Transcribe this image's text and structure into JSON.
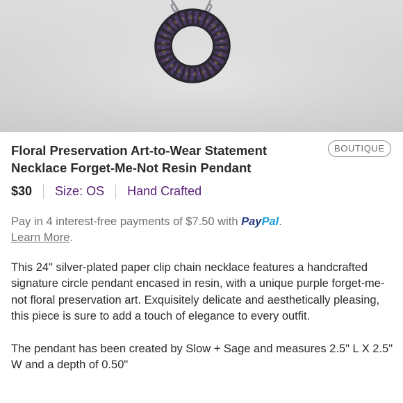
{
  "listing": {
    "title": "Floral Preservation Art-to-Wear Statement Necklace Forget-Me-Not Resin Pendant",
    "badge": "BOUTIQUE",
    "price": "$30",
    "size": "Size: OS",
    "brand": "Hand Crafted"
  },
  "payment": {
    "text": "Pay in 4 interest-free payments of $7.50 with",
    "paypal_pay": "Pay",
    "paypal_pal": "Pal",
    "learn_more": "Learn More",
    "after_link": "."
  },
  "description": {
    "paragraph1": "This 24\" silver-plated paper clip chain necklace features a handcrafted signature circle pendant encased in resin, with a unique purple forget-me-not floral preservation art. Exquisitely delicate and aesthetically pleasing, this piece is sure to add a touch of elegance to every outfit.",
    "paragraph2": "The pendant has been created by Slow + Sage and measures 2.5\" L X 2.5\" W and a depth of 0.50\""
  },
  "colors": {
    "accent_purple": "#5a1f7a",
    "paypal_dark": "#253b80",
    "paypal_light": "#169bd7"
  }
}
